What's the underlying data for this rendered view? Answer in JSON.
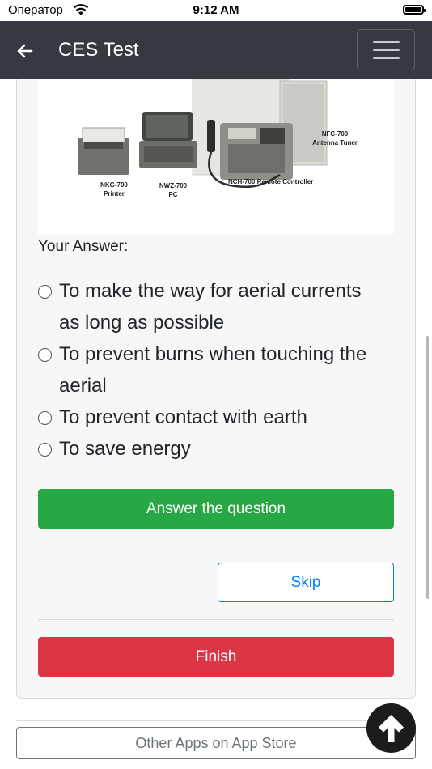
{
  "status_bar": {
    "carrier": "Оператор",
    "time": "9:12 AM"
  },
  "header": {
    "title": "CES Test"
  },
  "image": {
    "labels": {
      "printer_model": "NKG-700",
      "printer_name": "Printer",
      "pc_model": "NWZ-700",
      "pc_name": "PC",
      "controller": "NCH-700 Remote Controller",
      "tuner_model": "NFC-700",
      "tuner_name": "Antenna Tuner"
    }
  },
  "question": {
    "answer_label": "Your Answer:",
    "options": [
      {
        "line1": "To make the way for aerial currents",
        "line2": "as long as possible"
      },
      {
        "line1": "To prevent burns when touching the",
        "line2": "aerial"
      },
      {
        "line1": "To prevent contact with earth"
      },
      {
        "line1": "To save energy"
      }
    ]
  },
  "buttons": {
    "answer": "Answer the question",
    "skip": "Skip",
    "finish": "Finish",
    "other_apps": "Other Apps on App Store"
  },
  "colors": {
    "navbar": "#343a40",
    "answer": "#28a745",
    "skip": "#007bff",
    "finish": "#dc3545",
    "other": "#6c757d"
  }
}
